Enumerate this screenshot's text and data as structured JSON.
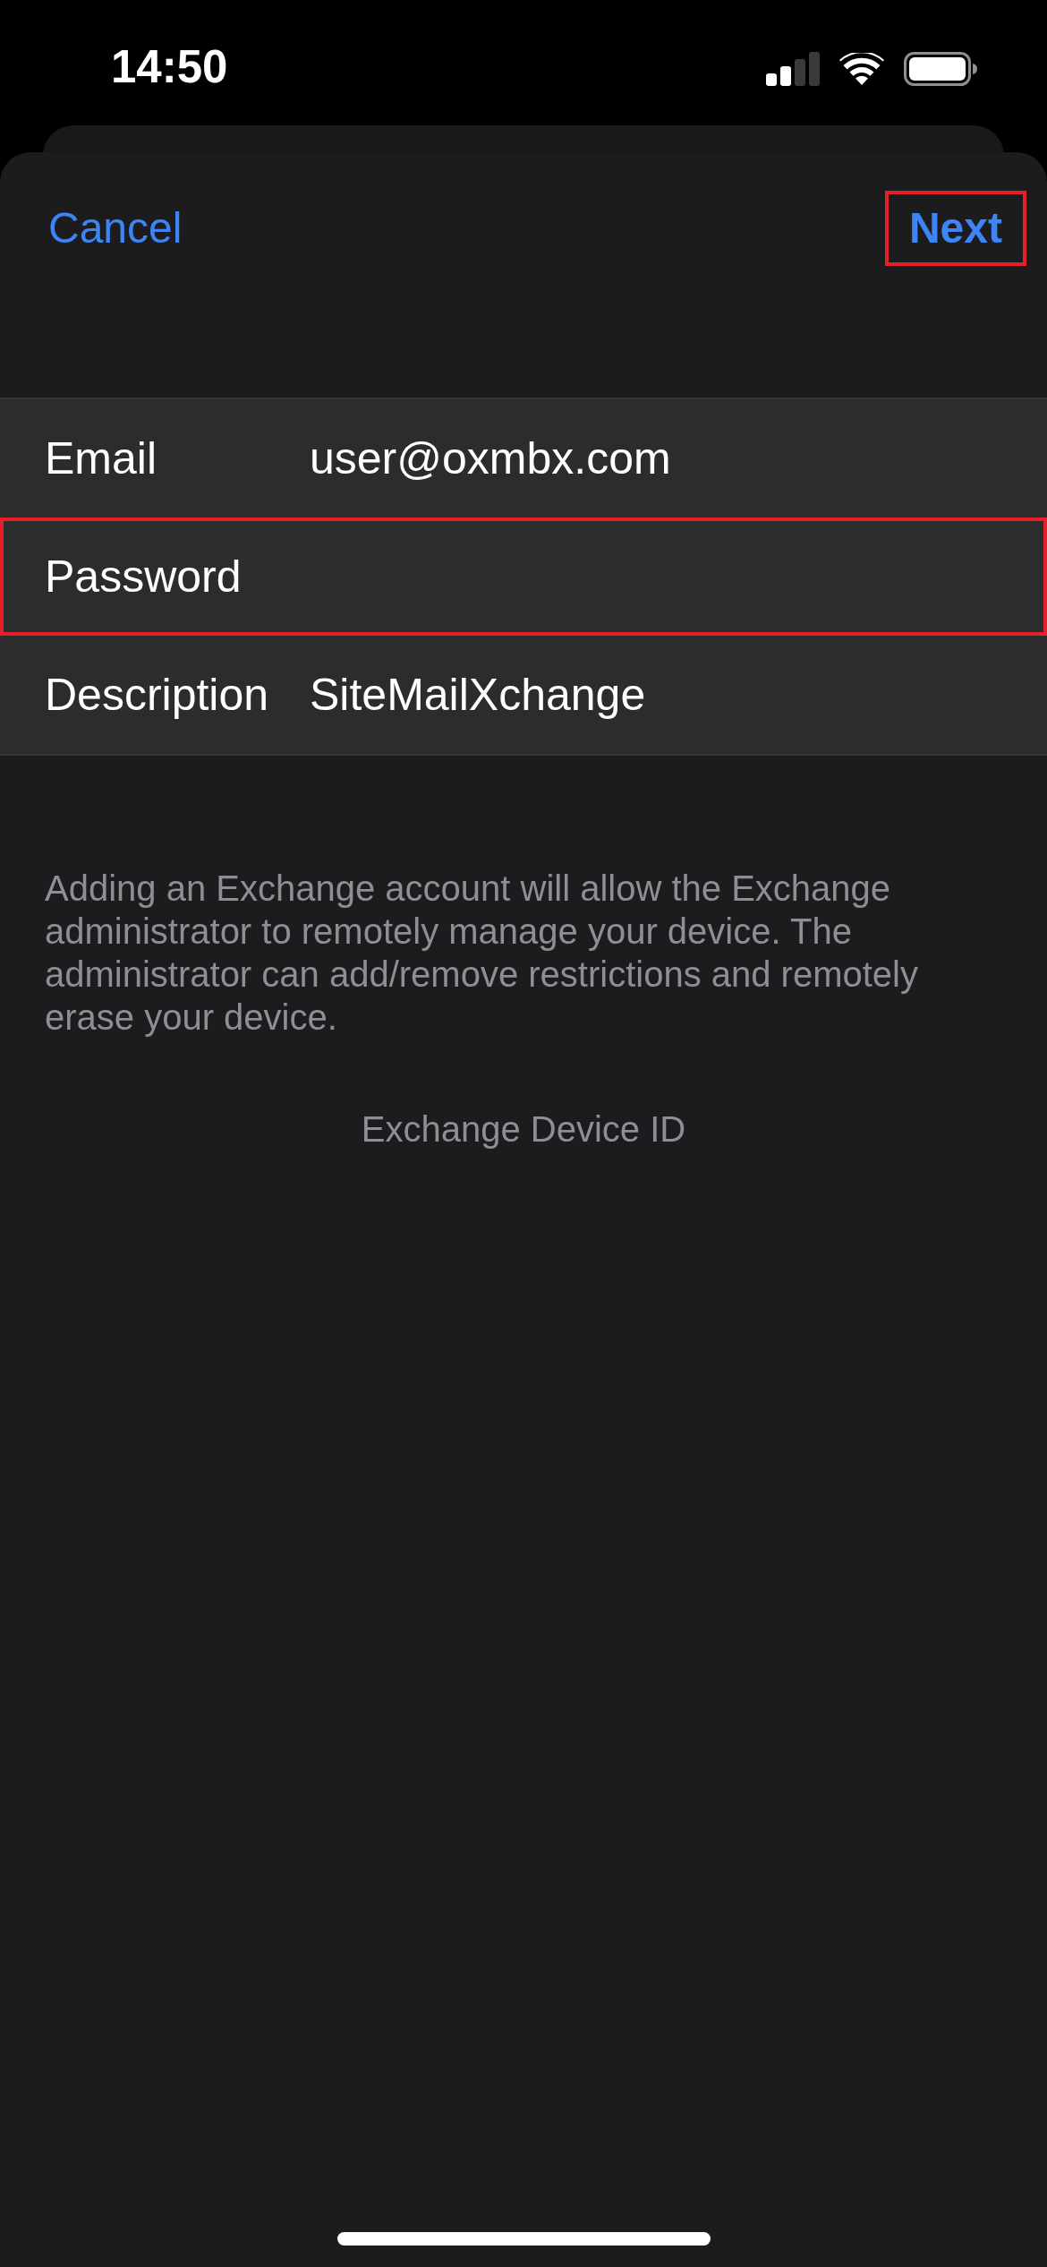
{
  "status_bar": {
    "time": "14:50"
  },
  "nav": {
    "cancel": {
      "label": "Cancel",
      "highlighted": false
    },
    "next": {
      "label": "Next",
      "highlighted": true
    }
  },
  "form": {
    "rows": [
      {
        "label": "Email",
        "value": "user@oxmbx.com",
        "highlighted": false
      },
      {
        "label": "Password",
        "highlighted": true
      },
      {
        "label": "Description",
        "value": "SiteMailXchange",
        "highlighted": false
      }
    ]
  },
  "footer": {
    "note": "Adding an Exchange account will allow the Exchange administrator to remotely manage your device. The administrator can add/remove restrictions and remotely erase your device.",
    "device_id_label": "Exchange Device ID"
  }
}
